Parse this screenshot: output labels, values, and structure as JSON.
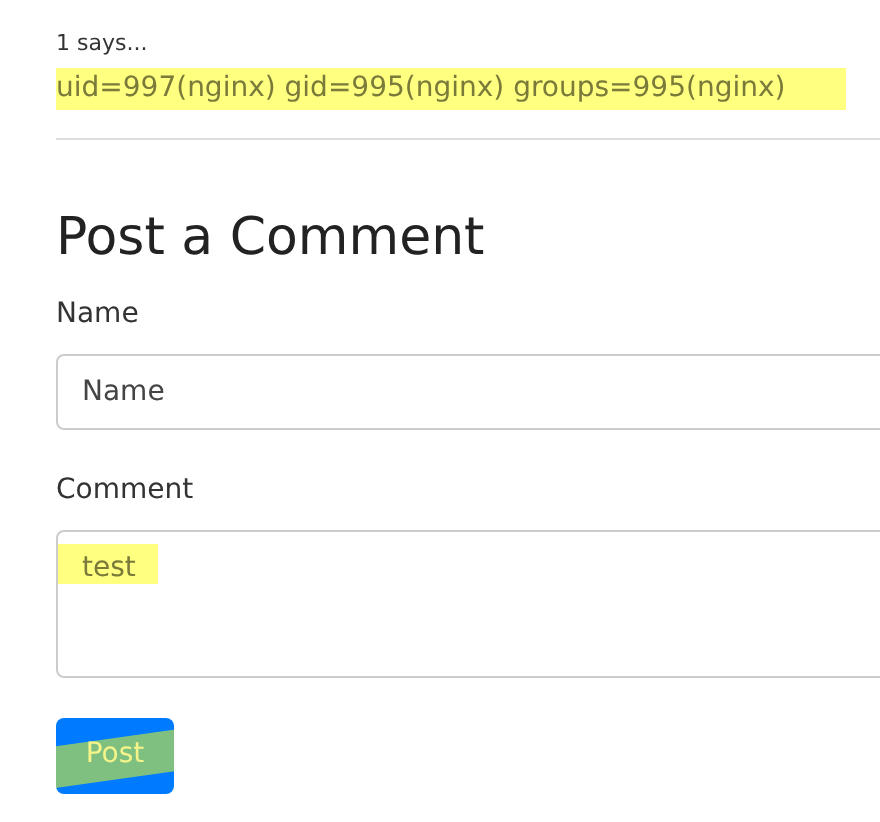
{
  "comment": {
    "author_line": "1 says...",
    "body": "uid=997(nginx) gid=995(nginx) groups=995(nginx)",
    "highlighted": true
  },
  "form": {
    "title": "Post a Comment",
    "fields": [
      {
        "kind": "input",
        "label": "Name",
        "placeholder": "Name"
      },
      {
        "kind": "textarea",
        "label": "Comment",
        "value": "test",
        "highlighted": true
      }
    ],
    "submit": {
      "label": "Post",
      "highlighted": true
    }
  }
}
